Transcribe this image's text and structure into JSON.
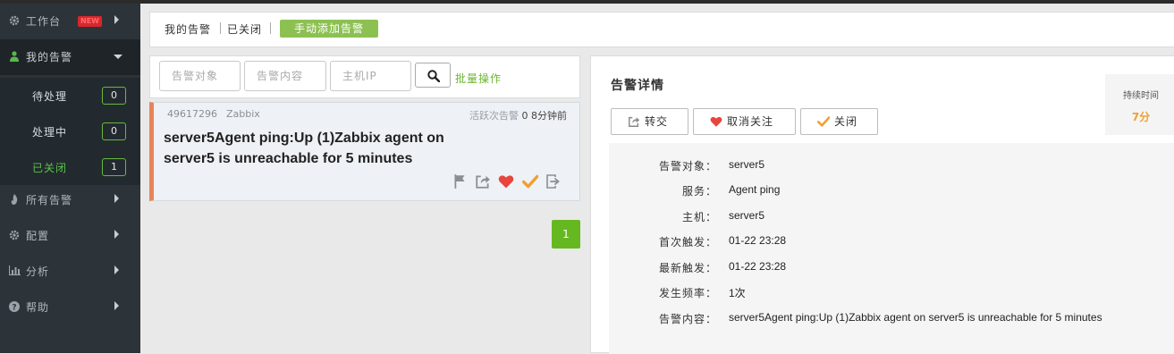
{
  "sidebar": {
    "items": [
      {
        "label": "工作台",
        "icon": "gear-icon",
        "badge": "NEW"
      },
      {
        "label": "我的告警",
        "icon": "user-icon",
        "open": true,
        "children": [
          {
            "label": "待处理",
            "count": "0"
          },
          {
            "label": "处理中",
            "count": "0"
          },
          {
            "label": "已关闭",
            "count": "1",
            "active": true
          }
        ]
      },
      {
        "label": "所有告警",
        "icon": "fire-icon"
      },
      {
        "label": "配置",
        "icon": "gear-icon"
      },
      {
        "label": "分析",
        "icon": "bar-chart-icon"
      },
      {
        "label": "帮助",
        "icon": "help-icon"
      }
    ]
  },
  "header": {
    "links": [
      "我的告警",
      "已关闭"
    ],
    "add_button": "手动添加告警"
  },
  "filters": {
    "target_placeholder": "告警对象",
    "content_placeholder": "告警内容",
    "host_placeholder": "主机IP",
    "batch_label": "批量操作"
  },
  "alarm": {
    "id": "49617296",
    "source": "Zabbix",
    "active_label": "活跃次告警",
    "active_count": "0",
    "time_ago": "8分钟前",
    "title": "server5Agent ping:Up (1)Zabbix agent on server5 is unreachable for 5 minutes"
  },
  "pagination": {
    "current": "1"
  },
  "detail": {
    "title": "告警详情",
    "buttons": {
      "forward": "转交",
      "unfollow": "取消关注",
      "close": "关闭"
    },
    "duration_label": "持续时间",
    "duration_value": "7分",
    "fields": [
      {
        "key": "告警对象：",
        "value": "server5"
      },
      {
        "key": "服务：",
        "value": "Agent ping"
      },
      {
        "key": "主机：",
        "value": "server5"
      },
      {
        "key": "首次触发：",
        "value": "01-22 23:28"
      },
      {
        "key": "最新触发：",
        "value": "01-22 23:28"
      },
      {
        "key": "发生频率：",
        "value": "1次"
      },
      {
        "key": "告警内容：",
        "value": "server5Agent ping:Up (1)Zabbix agent on server5 is unreachable for 5 minutes"
      }
    ]
  },
  "colors": {
    "sidebar_bg": "#2d3439",
    "accent_green": "#8cc152",
    "alarm_border": "#e9845a",
    "heart": "#e8453c",
    "check": "#f0a030"
  }
}
